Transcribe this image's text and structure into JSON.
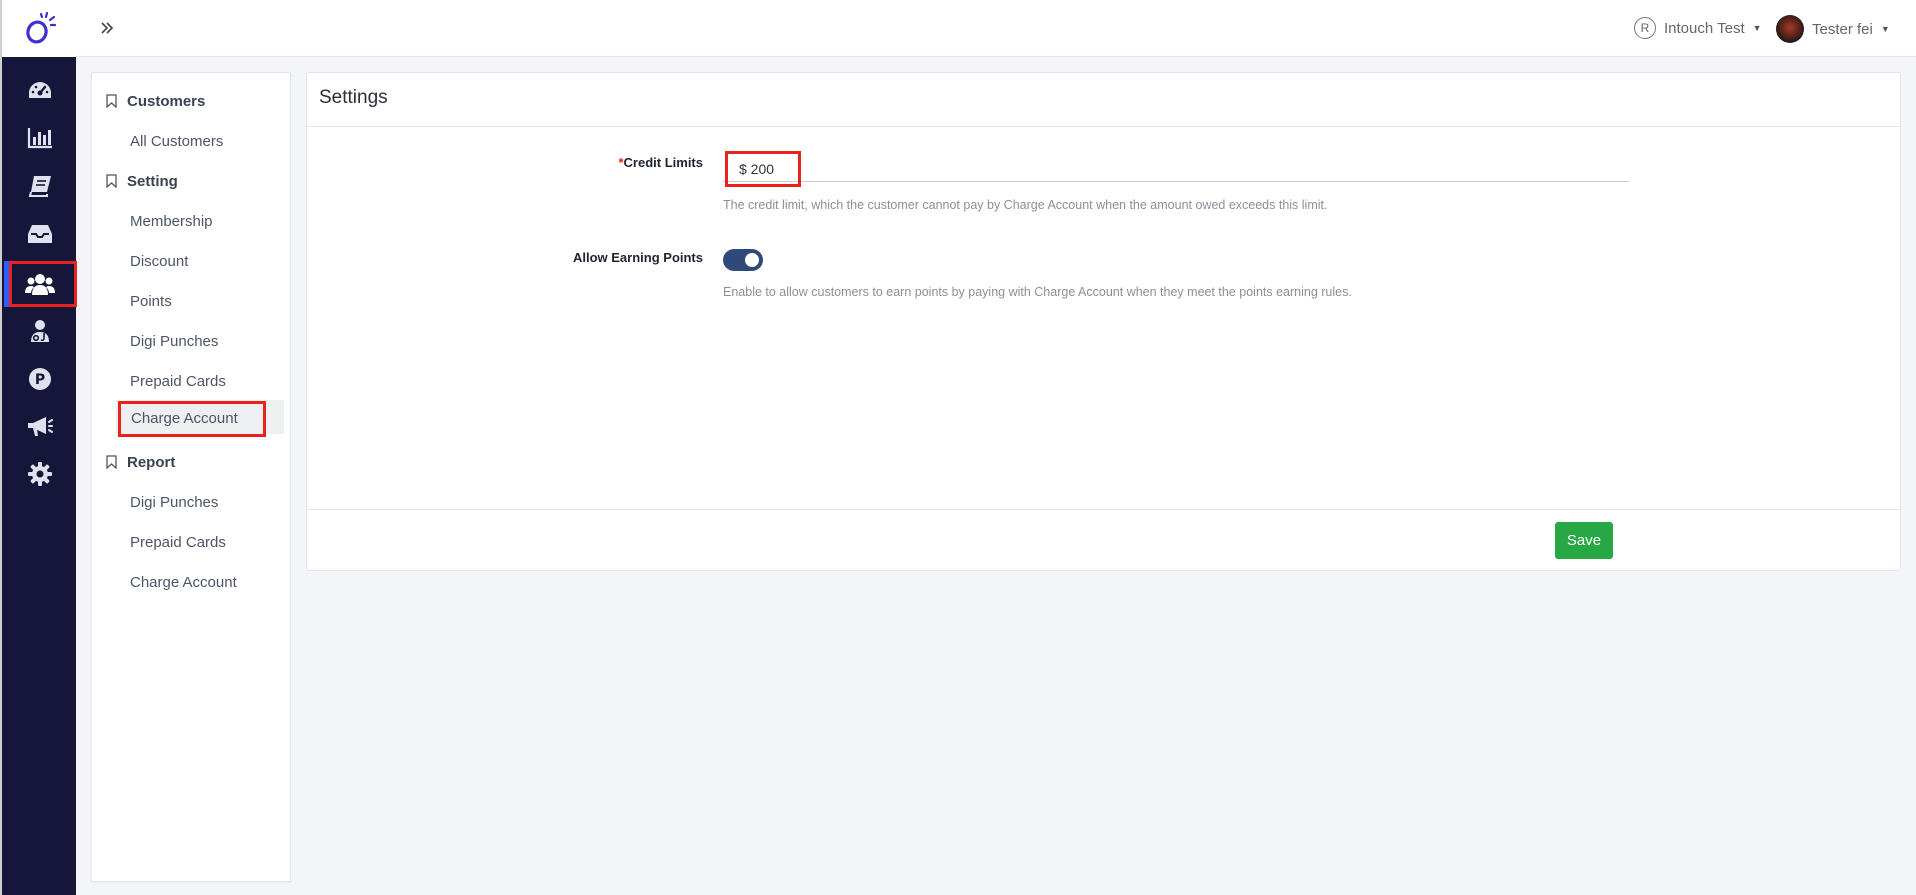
{
  "topbar": {
    "store_badge": "R",
    "store_name": "Intouch Test",
    "user_name": "Tester fei"
  },
  "rail": {
    "items": [
      {
        "icon": "dashboard-icon"
      },
      {
        "icon": "bar-chart-icon"
      },
      {
        "icon": "book-icon"
      },
      {
        "icon": "inbox-icon"
      },
      {
        "icon": "customers-icon",
        "active": true
      },
      {
        "icon": "staff-icon"
      },
      {
        "icon": "p-circle-icon"
      },
      {
        "icon": "megaphone-icon"
      },
      {
        "icon": "gear-icon"
      }
    ],
    "active_color": "#2e5cff"
  },
  "subnav": {
    "groups": [
      {
        "label": "Customers",
        "items": [
          "All Customers"
        ]
      },
      {
        "label": "Setting",
        "items": [
          "Membership",
          "Discount",
          "Points",
          "Digi Punches",
          "Prepaid Cards",
          "Charge Account"
        ]
      },
      {
        "label": "Report",
        "items": [
          "Digi Punches",
          "Prepaid Cards",
          "Charge Account"
        ]
      }
    ],
    "active_item": "Charge Account"
  },
  "settings": {
    "title": "Settings",
    "credit_limits": {
      "required_mark": "*",
      "label": "Credit Limits",
      "value": "$ 200",
      "help": "The credit limit, which the customer cannot pay by Charge Account when the amount owed exceeds this limit."
    },
    "allow_earning_points": {
      "label": "Allow Earning Points",
      "enabled": true,
      "help": "Enable to allow customers to earn points by paying with Charge Account when they meet the points earning rules."
    },
    "save_label": "Save"
  },
  "colors": {
    "rail_bg": "#15163a",
    "highlight_red": "#e8231d",
    "toggle_on": "#2f4a7a",
    "save_green": "#28a745"
  }
}
